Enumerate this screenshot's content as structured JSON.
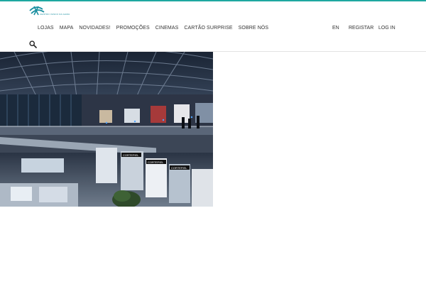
{
  "header": {
    "logo_text": "CENTRO VASCO DA GAMA",
    "nav": [
      {
        "label": "LOJAS"
      },
      {
        "label": "MAPA"
      },
      {
        "label": "NOVIDADES!"
      },
      {
        "label": "PROMOÇÕES"
      },
      {
        "label": "CINEMAS"
      },
      {
        "label": "CARTÃO SURPRISE"
      },
      {
        "label": "SOBRE NÓS"
      }
    ],
    "language": "EN",
    "register_label": "REGISTAR",
    "login_label": "LOG IN",
    "search_icon": "search-icon"
  },
  "hero": {
    "image": "shopping-mall-interior",
    "store_signs": [
      "CORTEFIEL",
      "CORTEFIEL",
      "CORTEFIEL"
    ]
  },
  "colors": {
    "accent": "#1ea8a0",
    "text": "#333333",
    "logo": "#1a8fa0"
  }
}
